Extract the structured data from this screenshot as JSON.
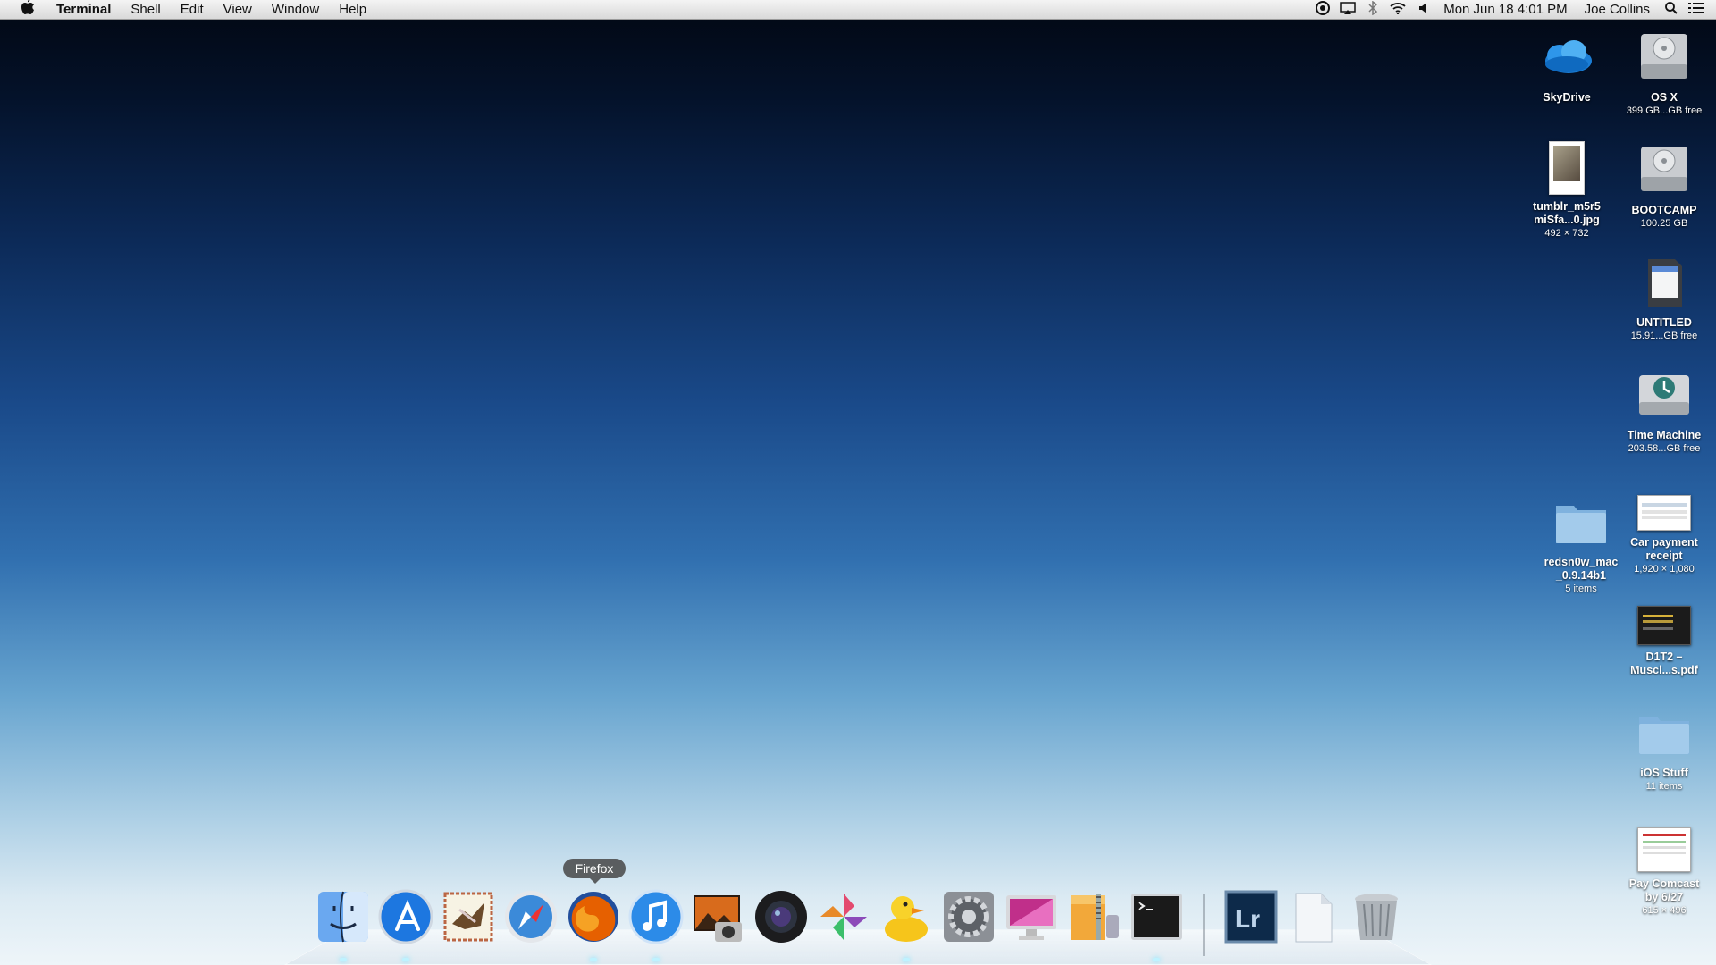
{
  "menubar": {
    "apple_icon": "apple-logo-icon",
    "app_name": "Terminal",
    "menus": [
      "Shell",
      "Edit",
      "View",
      "Window",
      "Help"
    ],
    "clock": "Mon Jun 18  4:01 PM",
    "user": "Joe Collins",
    "status_icons": [
      "adium-icon",
      "airplay-icon",
      "bluetooth-icon",
      "wifi-icon",
      "volume-icon"
    ]
  },
  "desktop": {
    "skydrive": {
      "label": "SkyDrive"
    },
    "osx": {
      "label": "OS X",
      "sub": "399 GB...GB free"
    },
    "tumblr": {
      "label": "tumblr_m5r5\nmiSfa...0.jpg",
      "sub": "492 × 732"
    },
    "bootcamp": {
      "label": "BOOTCAMP",
      "sub": "100.25 GB"
    },
    "untitled": {
      "label": "UNTITLED",
      "sub": "15.91...GB free"
    },
    "timemachine": {
      "label": "Time Machine",
      "sub": "203.58...GB free"
    },
    "redsn0w": {
      "label": "redsn0w_mac\n_0.9.14b1",
      "sub": "5 items"
    },
    "carpayment": {
      "label": "Car payment\nreceipt",
      "sub": "1,920 × 1,080"
    },
    "d1t2": {
      "label": "D1T2 –\nMuscl...s.pdf"
    },
    "iosstuff": {
      "label": "iOS Stuff",
      "sub": "11 items"
    },
    "paycomcast": {
      "label": "Pay Comcast\nby 6/27",
      "sub": "615 × 496"
    }
  },
  "dock": {
    "tooltip": "Firefox",
    "items": [
      "Finder",
      "App Store",
      "Mail",
      "Safari",
      "Firefox",
      "iTunes",
      "iPhoto",
      "Aperture",
      "Photos",
      "Cyberduck",
      "System Preferences",
      "CleanMyMac",
      "Archive Utility",
      "Terminal",
      "Lightroom",
      "Documents",
      "Trash"
    ]
  },
  "colors": {
    "firefox_orange": "#e66000",
    "terminal_black": "#1a1a1a",
    "lightroom_blue": "#0d2a4a"
  }
}
